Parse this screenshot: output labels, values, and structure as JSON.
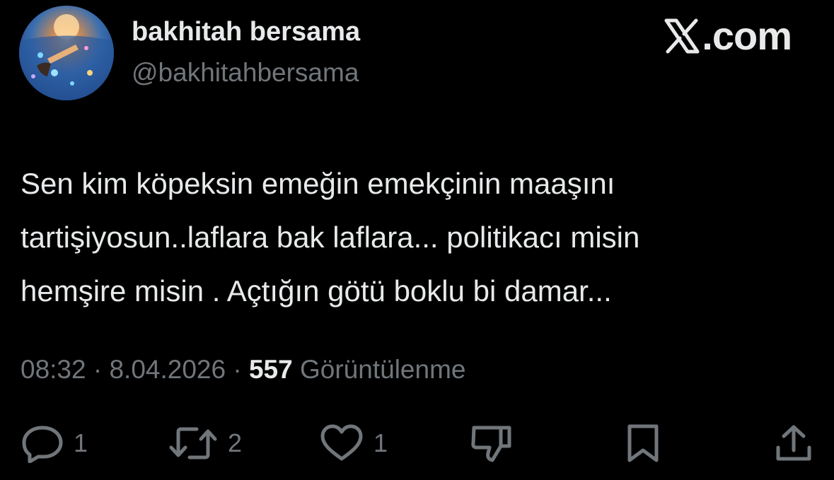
{
  "author": {
    "display_name": "bakhitah bersama",
    "handle": "@bakhitahbersama"
  },
  "brand": {
    "domain_suffix": ".com",
    "icon": "x-logo-icon"
  },
  "tweet": {
    "lines": [
      "Sen kim köpeksin emeğin emekçinin maaşını",
      "tartişiyosun..laflara bak laflara... politikacı misin",
      "hemşire misin . Açtığın götü boklu bi damar..."
    ]
  },
  "meta": {
    "time": "08:32",
    "separator": "·",
    "date": "8.04.2026",
    "views_count": "557",
    "views_label": "Görüntülenme"
  },
  "actions": {
    "reply": {
      "icon": "reply-icon",
      "count": "1"
    },
    "retweet": {
      "icon": "retweet-icon",
      "count": "2"
    },
    "like": {
      "icon": "heart-icon",
      "count": "1"
    },
    "dislike": {
      "icon": "thumbs-down-icon"
    },
    "bookmark": {
      "icon": "bookmark-icon"
    },
    "share": {
      "icon": "share-icon"
    }
  },
  "colors": {
    "background": "#000000",
    "primary_text": "#e7e9ea",
    "secondary_text": "#71767b"
  }
}
